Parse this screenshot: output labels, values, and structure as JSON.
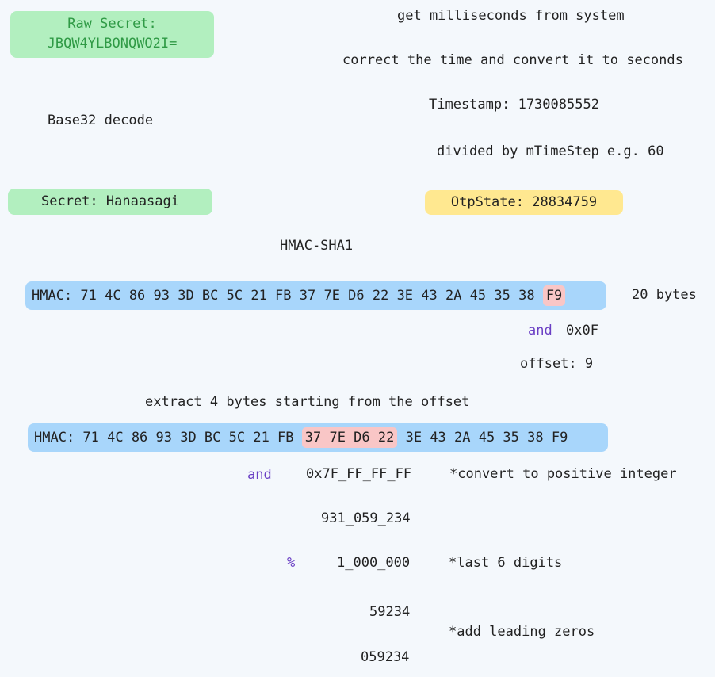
{
  "raw_secret": {
    "label": "Raw Secret:",
    "value": "JBQW4YLBONQWO2I="
  },
  "base32_decode": "Base32 decode",
  "secret": "Secret: Hanaasagi",
  "time_steps": {
    "step1": "get milliseconds from system",
    "step2": "correct the time and convert it to seconds",
    "timestamp": "Timestamp: 1730085552",
    "step3": "divided by mTimeStep e.g. 60"
  },
  "otp_state": "OtpState: 28834759",
  "hmac_sha1": "HMAC-SHA1",
  "hmac1": {
    "prefix": "HMAC: 71 4C 86 93 3D BC 5C 21 FB 37 7E D6 22 3E 43 2A 45 35 38",
    "highlight": "F9"
  },
  "bytes_label": "20 bytes",
  "and_op": "and",
  "mask_0f": "0x0F",
  "offset": "offset: 9",
  "extract": "extract 4 bytes starting from the offset",
  "hmac2": {
    "prefix": "HMAC: 71 4C 86 93 3D BC 5C 21 FB",
    "highlight": "37 7E D6 22",
    "suffix": "3E 43 2A 45 35 38 F9"
  },
  "and_op2": "and",
  "mask_7f": "0x7F_FF_FF_FF",
  "note_positive": "*convert to positive integer",
  "int_value": "931_059_234",
  "mod_op": "%",
  "modulus": "1_000_000",
  "note_last6": "*last 6 digits",
  "result": "59234",
  "note_zeros": "*add leading zeros",
  "final_code": "059234",
  "colors": {
    "green_box": "#b2efbf",
    "green_text": "#2f9a45",
    "yellow_box": "#ffe890",
    "blue_box": "#a8d6fb",
    "highlight": "#f9c6c6",
    "operator": "#6a3fc4"
  }
}
